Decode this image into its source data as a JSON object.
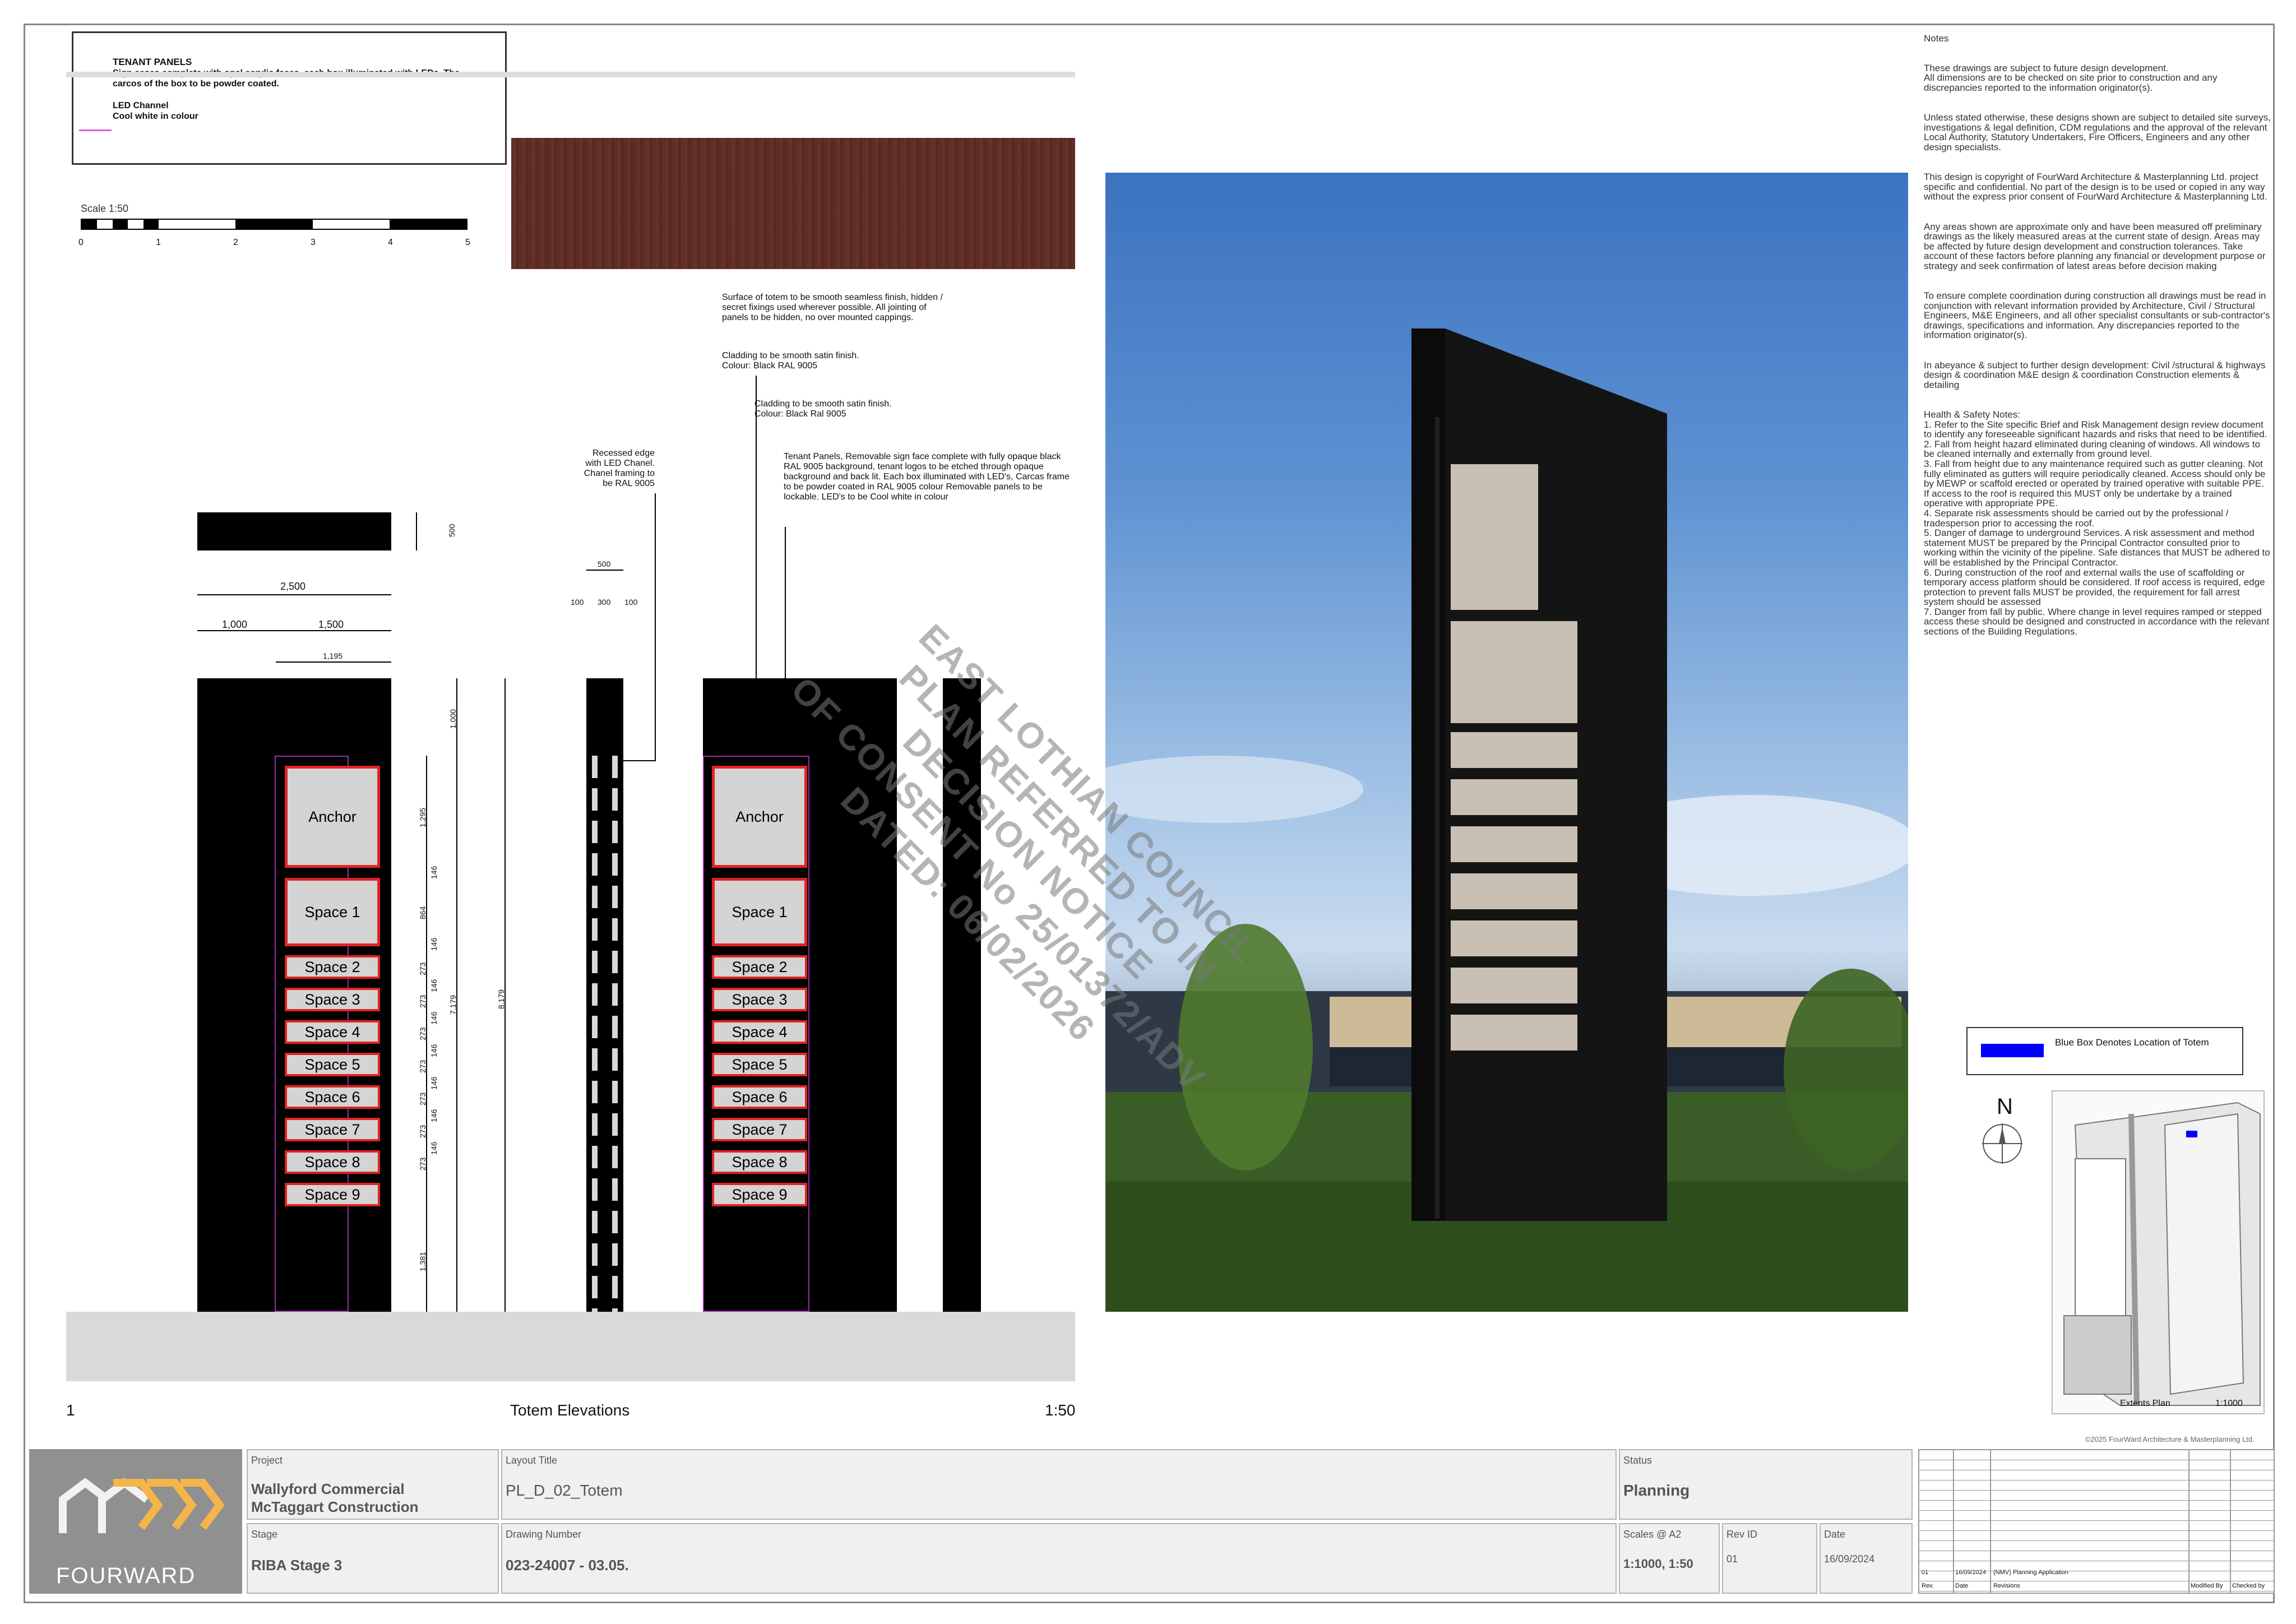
{
  "legend": {
    "heading": "TENANT PANELS",
    "text": "Sign cases complete with opal acrylic faces, each box illuminated with LEDs. The carcos of the box to be powder coated.",
    "led_heading": "LED Channel",
    "led_text": "Cool white in colour"
  },
  "scale": {
    "label": "Scale 1:50",
    "ticks": [
      "0",
      "1",
      "2",
      "3",
      "4",
      "5"
    ]
  },
  "annotations": {
    "surface": "Surface of totem to be smooth seamless finish, hidden / secret fixings used wherever possible. All jointing of panels to be hidden, no over mounted cappings.",
    "cladding1": "Cladding to be smooth satin finish.\nColour: Black RAL 9005",
    "cladding2": "Cladding to be smooth satin finish.\nColour: Black Ral 9005",
    "tenant": "Tenant Panels, Removable sign face complete with fully opaque black RAL 9005 background, tenant logos to be etched through opaque background and back lit. Each box illuminated with LED's, Carcas frame to be powder coated in RAL 9005 colour Removable panels to be lockable. LED's to be Cool white in colour",
    "recessed": "Recessed edge\nwith LED Chanel.\nChanel framing to\nbe RAL 9005"
  },
  "dimensions": {
    "d500_top": "500",
    "d2500": "2,500",
    "d1000": "1,000",
    "d1500": "1,500",
    "d1195": "1,195",
    "d1000v": "1,000",
    "d1295": "1,295",
    "d146a": "146",
    "d864": "864",
    "d146b": "146",
    "d273": "273",
    "d146": "146",
    "d7179": "7,179",
    "d8179": "8,179",
    "d1381": "1,381",
    "side500": "500",
    "side100a": "100",
    "side300": "300",
    "side100b": "100"
  },
  "panels": [
    "Anchor",
    "Space 1",
    "Space 2",
    "Space 3",
    "Space 4",
    "Space 5",
    "Space 6",
    "Space 7",
    "Space 8",
    "Space 9"
  ],
  "drawing": {
    "number": "1",
    "title": "Totem Elevations",
    "scale": "1:50"
  },
  "stamp": {
    "line1": "EAST LOTHIAN COUNCIL",
    "line2": "PLAN REFERRED TO IN DECISION NOTICE",
    "line3": "OF CONSENT No 25/01372/ADV",
    "line4": "DATED: 06/02/2026"
  },
  "notes": {
    "heading": "Notes",
    "p1": "These drawings are subject to future design development.\nAll dimensions are to be checked on site prior to construction and any discrepancies reported to the information originator(s).",
    "p2": "Unless stated otherwise, these designs shown are subject to detailed site surveys, investigations & legal definition, CDM regulations and the approval of the relevant Local Authority, Statutory Undertakers, Fire Officers, Engineers and any other design specialists.",
    "p3": "This design is copyright of FourWard Architecture & Masterplanning Ltd. project specific and confidential. No part of the design is to be used or copied in any way without the express prior consent of FourWard Architecture & Masterplanning Ltd.",
    "p4": "Any areas shown are approximate only and have been measured off preliminary drawings as the likely measured areas at the current state of design. Areas may be affected by future design development and construction tolerances. Take account of these factors before planning any financial or development purpose or strategy and seek confirmation of latest areas before decision making",
    "p5": "To ensure complete coordination during construction all drawings must be read in conjunction with relevant information provided by Architecture, Civil / Structural Engineers, M&E Engineers, and all other specialist consultants or sub-contractor's drawings, specifications and information. Any discrepancies reported to the information originator(s).",
    "p6": "In abeyance & subject to further design development: Civil /structural & highways design & coordination M&E design & coordination Construction elements & detailing",
    "p7": "Health & Safety Notes:\n1. Refer to the Site specific Brief and Risk Management design review document to identify any foreseeable significant hazards and risks that need to be identified.\n2. Fall from height hazard eliminated during cleaning of windows. All windows to be cleaned internally and externally from ground level.\n3. Fall from height due to any maintenance required such as gutter cleaning. Not fully eliminated as gutters will require periodically cleaned. Access should only be by MEWP or scaffold erected or operated by trained operative with suitable PPE. If access to the roof is required this MUST only be undertake by a trained operative with appropriate PPE.\n4. Separate risk assessments should be carried out by the professional / tradesperson prior to accessing the roof.\n5. Danger of damage to underground Services. A risk assessment and method statement MUST be prepared by the Principal Contractor consulted prior to working within the vicinity of the pipeline. Safe distances that MUST be adhered to will be established by the Principal Contractor.\n6. During construction of the roof and external walls the use of scaffolding or temporary access platform should be considered. If roof access is required, edge protection to prevent falls MUST be provided, the requirement for fall arrest system should be assessed\n7. Danger from fall by public. Where change in level requires ramped or stepped access these should be designed and constructed in accordance with the relevant sections of the Building Regulations."
  },
  "location": {
    "legend": "Blue Box Denotes Location of Totem",
    "north": "N",
    "map_label": "Extents Plan",
    "map_scale": "1:1000",
    "bluebox_color": "#0000ff"
  },
  "title_block": {
    "logo": "FOURWARD",
    "copyright": "©2025 FourWard Architecture & Masterplanning Ltd.",
    "project_label": "Project",
    "project_line1": "Wallyford Commercial",
    "project_line2": "McTaggart Construction",
    "layout_label": "Layout Title",
    "layout_value": "PL_D_02_Totem",
    "status_label": "Status",
    "status_value": "Planning",
    "stage_label": "Stage",
    "stage_value": "RIBA Stage 3",
    "number_label": "Drawing Number",
    "number_value": "023-24007  - 03.05.",
    "scales_label": "Scales @ A2",
    "scales_value": "1:1000, 1:50",
    "rev_label": "Rev ID",
    "rev_value": "01",
    "date_label": "Date",
    "date_value": "16/09/2024"
  },
  "revisions": {
    "row": [
      "01",
      "16/09/2024",
      "(NMV) Planning Application"
    ],
    "headers": [
      "Rev.",
      "Date",
      "Revisions",
      "Modified By",
      "Checked by"
    ]
  }
}
